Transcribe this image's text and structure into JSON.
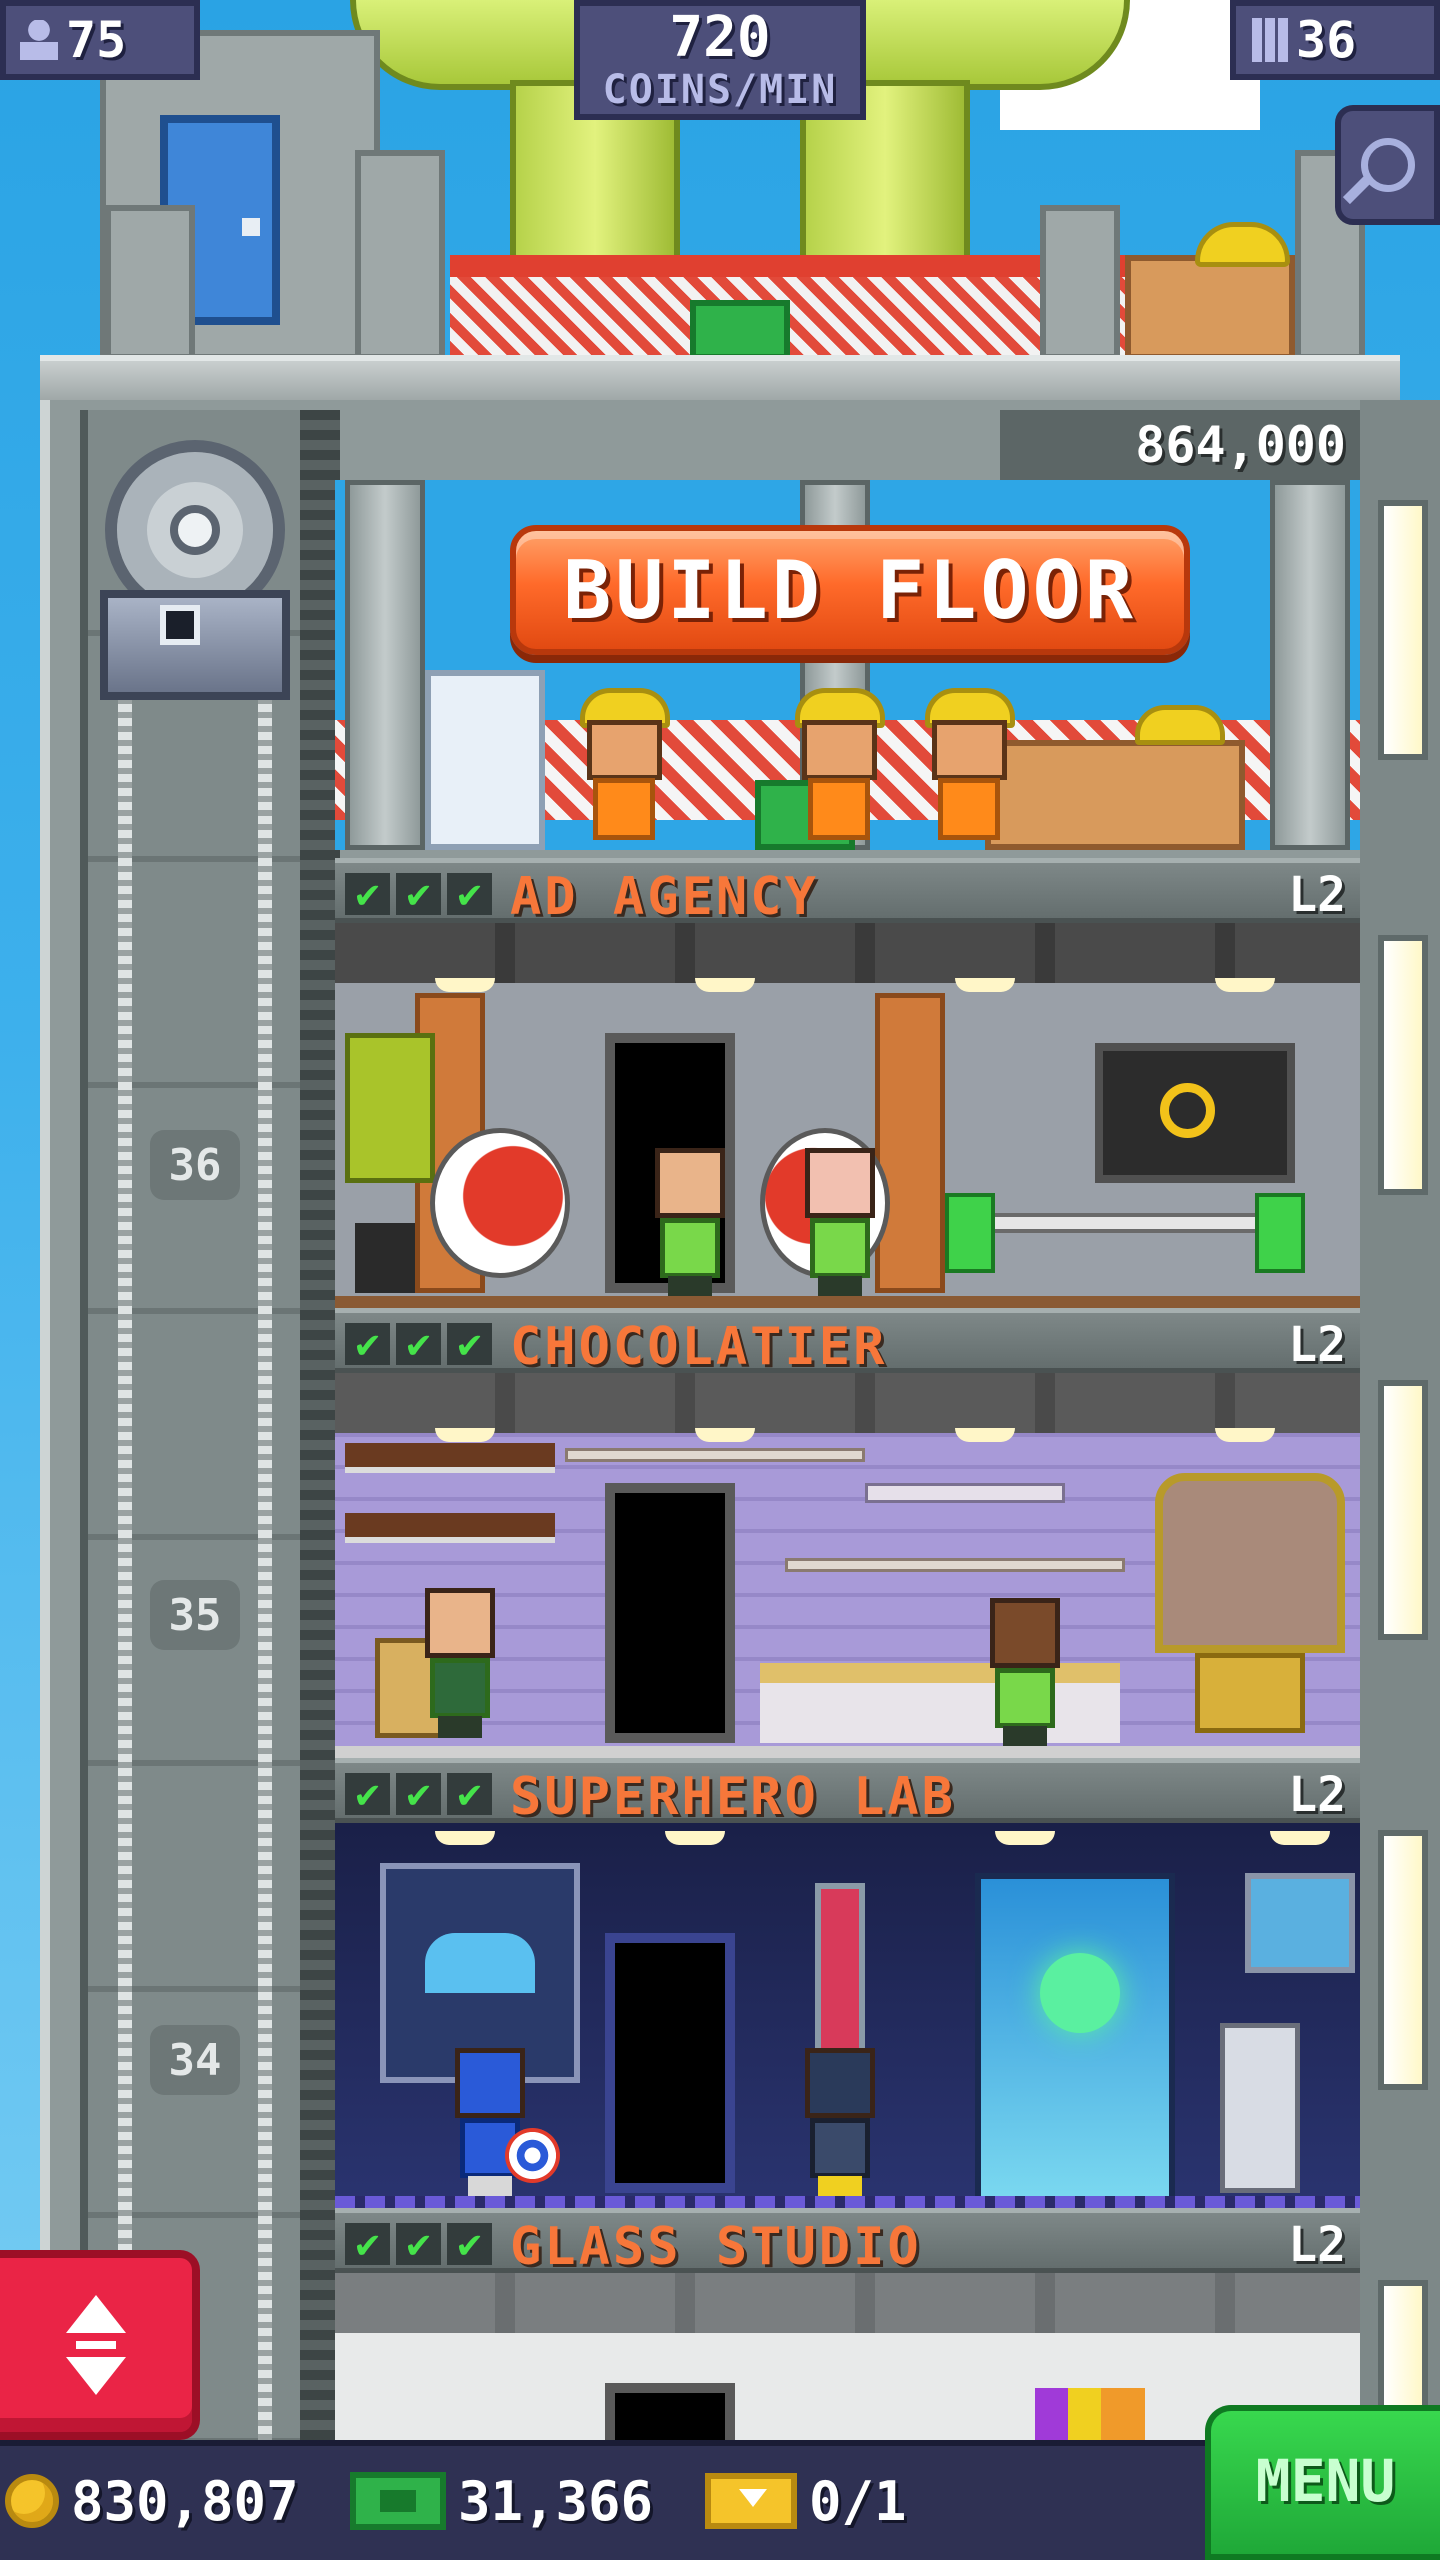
{
  "hud": {
    "population": "75",
    "coins_per_min": "720",
    "coins_per_min_label": "COINS/MIN",
    "floors_count": "36",
    "population_icon": "person-icon",
    "floors_icon": "building-icon"
  },
  "build": {
    "cost": "864,000",
    "button_label": "BUILD FLOOR"
  },
  "floors": [
    {
      "name": "AD AGENCY",
      "level": "L2",
      "number": "36"
    },
    {
      "name": "CHOCOLATIER",
      "level": "L2",
      "number": "35"
    },
    {
      "name": "SUPERHERO LAB",
      "level": "L2",
      "number": "34"
    },
    {
      "name": "GLASS STUDIO",
      "level": "L2"
    }
  ],
  "checks": "✔",
  "bottom": {
    "coins": "830,807",
    "bux": "31,366",
    "tickets": "0/1",
    "menu_label": "MENU"
  },
  "colors": {
    "hud_bg": "#4d4f7a",
    "build_button": "#ff6a2a",
    "floor_name": "#f7773a",
    "check_green": "#45e34a",
    "elevator_button": "#ea2446",
    "menu_button": "#1fa838"
  }
}
